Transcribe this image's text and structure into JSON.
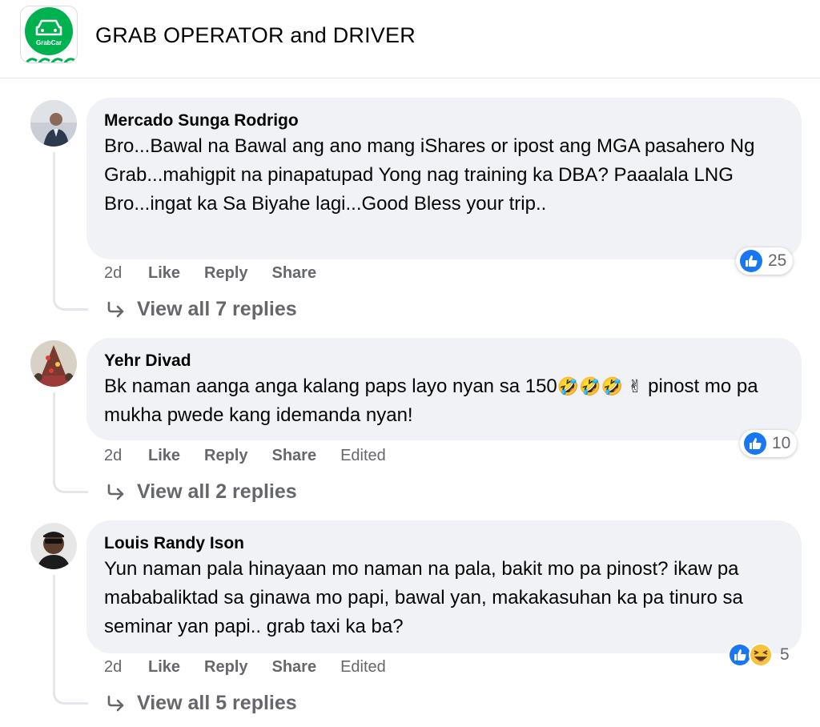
{
  "header": {
    "group_name": "GRAB OPERATOR and DRIVER",
    "logo_text": "GrabCar"
  },
  "comments": [
    {
      "author": "Mercado Sunga Rodrigo",
      "text": "Bro...Bawal na Bawal ang ano mang iShares or ipost ang MGA pasahero Ng Grab...mahigpit na pinapatupad Yong nag training ka DBA? Paaalala LNG Bro...ingat ka Sa Biyahe lagi...Good Bless your trip..",
      "time": "2d",
      "like": "Like",
      "reply": "Reply",
      "share": "Share",
      "reaction_count": "25",
      "view_replies": "View all 7 replies"
    },
    {
      "author": "Yehr Divad",
      "text_before": "Bk naman aanga anga kalang paps layo nyan sa 150",
      "emojis": "🤣🤣🤣 ✌",
      "text_after": " pinost mo pa mukha pwede kang idemanda nyan!",
      "time": "2d",
      "like": "Like",
      "reply": "Reply",
      "share": "Share",
      "edited": "Edited",
      "reaction_count": "10",
      "view_replies": "View all 2 replies"
    },
    {
      "author": "Louis Randy Ison",
      "text": "Yun naman pala hinayaan mo naman na pala, bakit mo pa pinost? ikaw pa mababaliktad sa ginawa mo papi, bawal yan, makakasuhan ka pa tinuro sa seminar yan papi.. grab taxi ka ba?",
      "time": "2d",
      "like": "Like",
      "reply": "Reply",
      "share": "Share",
      "edited": "Edited",
      "reaction_count": "5",
      "view_replies": "View all 5 replies"
    }
  ],
  "colors": {
    "grab_green": "#00b14f",
    "like_blue": "#1877f2",
    "bubble_bg": "#f0f2f5",
    "meta_gray": "#65676b"
  },
  "icons": [
    "grabcar-logo",
    "like-reaction-icon",
    "haha-reaction-icon",
    "reply-arrow-icon"
  ]
}
